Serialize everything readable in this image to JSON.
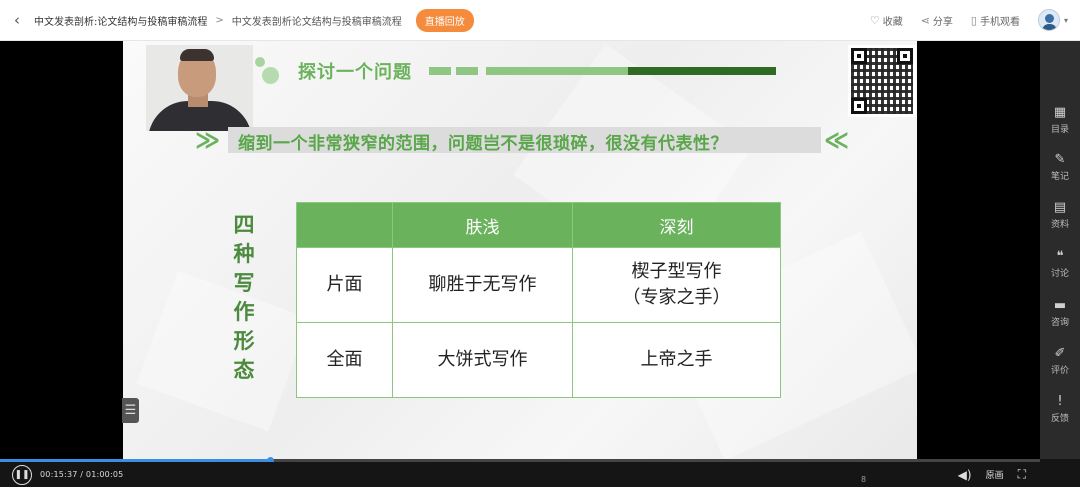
{
  "topbar": {
    "back_icon": "chevron-left-icon",
    "breadcrumb": [
      "中文发表剖析:论文结构与投稿审稿流程",
      "中文发表剖析论文结构与投稿审稿流程"
    ],
    "separator": ">",
    "live_badge": "直播回放",
    "live_badge_color": "#f58b3c",
    "actions": [
      {
        "icon": "heart-icon",
        "label": "收藏"
      },
      {
        "icon": "share-icon",
        "label": "分享"
      },
      {
        "icon": "phone-icon",
        "label": "手机观看"
      }
    ],
    "avatar_caret": "▾"
  },
  "slide": {
    "heading": "探讨一个问题",
    "question": "缩到一个非常狭窄的范围，问题岂不是很琐碎，很没有代表性？",
    "left_chevron": "≫",
    "right_chevron": "≪",
    "vertical_title": [
      "四",
      "种",
      "写",
      "作",
      "形",
      "态"
    ],
    "table": {
      "headers": [
        "",
        "肤浅",
        "深刻"
      ],
      "rows": [
        {
          "label": "片面",
          "shallow": "聊胜于无写作",
          "deep_line1": "楔子型写作",
          "deep_line2": "（专家之手）"
        },
        {
          "label": "全面",
          "shallow": "大饼式写作",
          "deep_line1": "上帝之手",
          "deep_line2": ""
        }
      ]
    },
    "accent_color": "#6bb25c",
    "page_number": "8",
    "side_tab_icon": "list-icon"
  },
  "sidebar": {
    "items": [
      {
        "icon": "grid-icon",
        "label": "目录"
      },
      {
        "icon": "note-icon",
        "label": "笔记"
      },
      {
        "icon": "folder-icon",
        "label": "资料"
      },
      {
        "icon": "chat-icon",
        "label": "讨论"
      },
      {
        "icon": "question-icon",
        "label": "咨询"
      },
      {
        "icon": "edit-icon",
        "label": "评价"
      },
      {
        "icon": "feedback-icon",
        "label": "反馈"
      }
    ]
  },
  "player": {
    "current_time": "00:15:37",
    "total_time": "01:00:05",
    "time_display": "00:15:37 / 01:00:05",
    "progress": 0.26,
    "quality": "原画",
    "volume_icon": "volume-icon",
    "fullscreen_icon": "fullscreen-icon",
    "play_icon": "pause-icon"
  }
}
